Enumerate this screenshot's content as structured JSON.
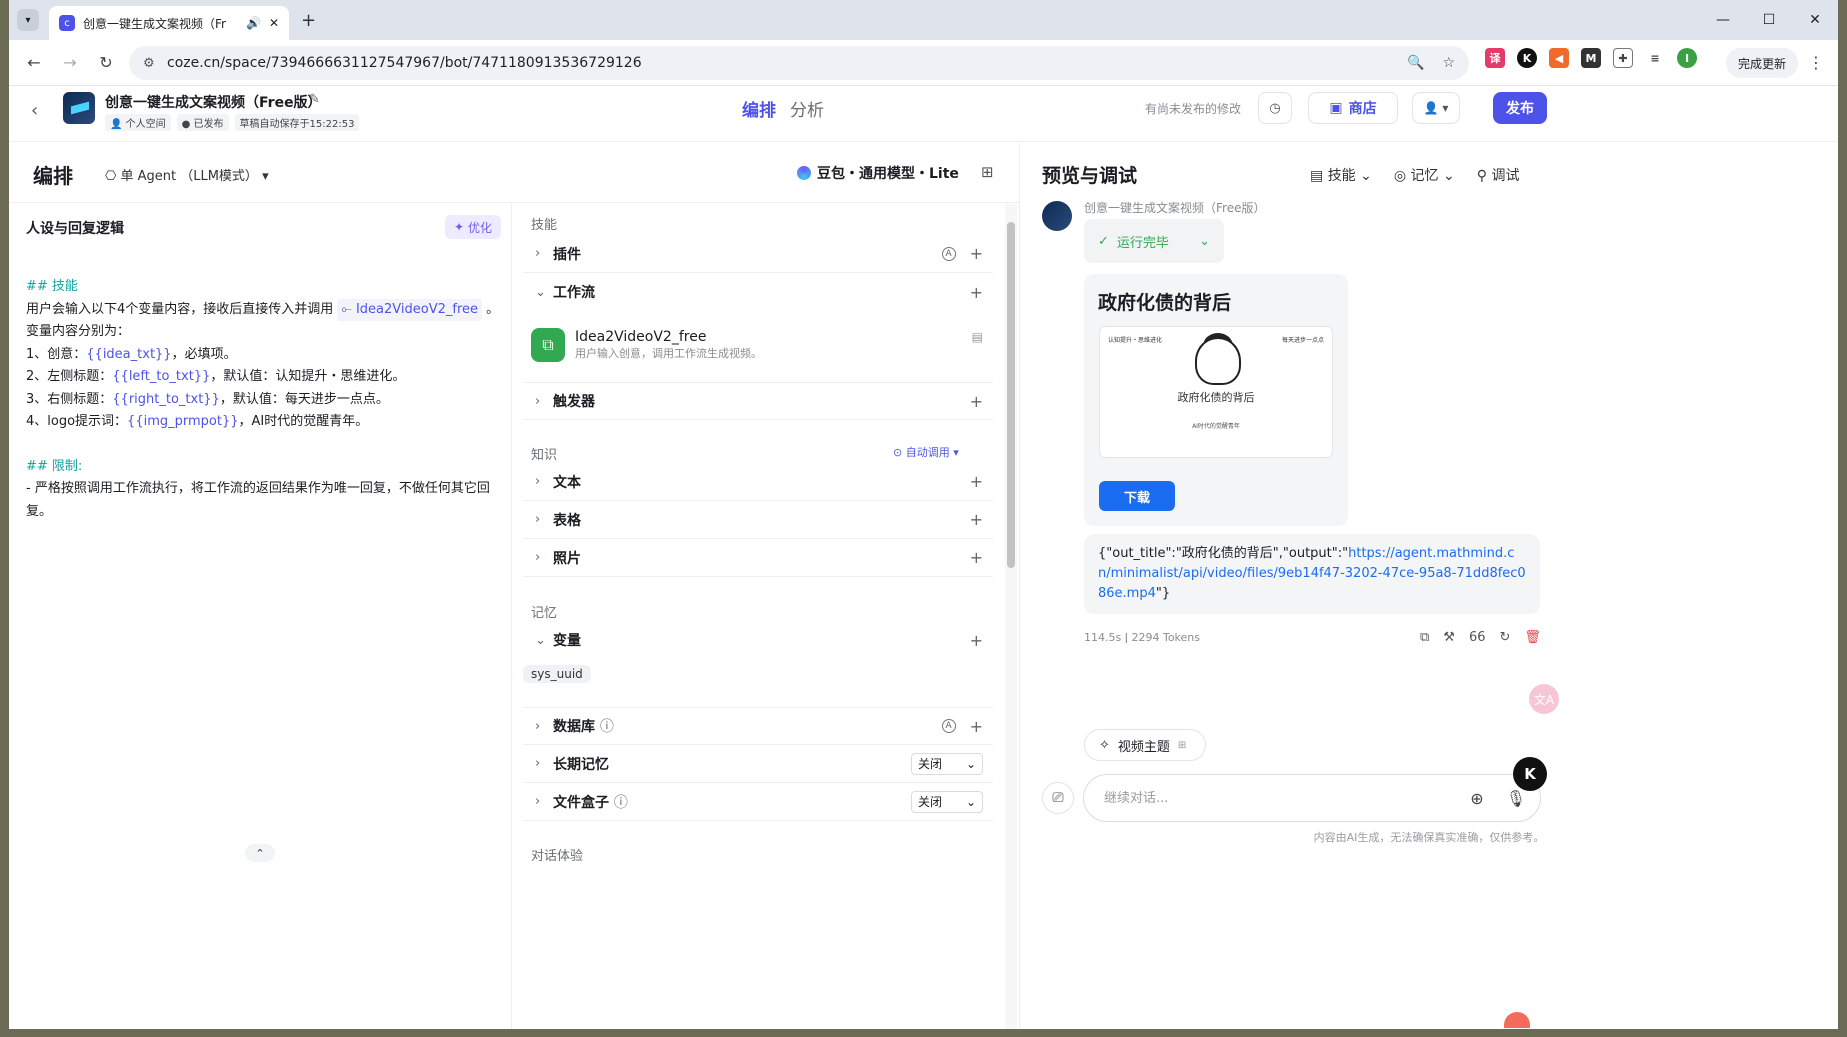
{
  "browser": {
    "tab_title": "创意一键生成文案视频（Fr",
    "url": "coze.cn/space/7394666631127547967/bot/7471180913536729126",
    "update_label": "完成更新",
    "window_controls": [
      "—",
      "☐",
      "✕"
    ]
  },
  "header": {
    "bot_name": "创意一键生成文案视频（Free版）",
    "badges": [
      "个人空间",
      "已发布",
      "草稿自动保存于15:22:53"
    ],
    "modes": [
      "编排",
      "分析"
    ],
    "unpublished_note": "有尚未发布的修改",
    "store_label": "商店",
    "publish_label": "发布"
  },
  "toolbar": {
    "title": "编排",
    "agent_mode": "单 Agent （LLM模式）",
    "model": "豆包・通用模型・Lite"
  },
  "persona": {
    "heading": "人设与回复逻辑",
    "optimize_label": "优化",
    "skills_h": "## 技能",
    "line1a": "用户会输入以下4个变量内容，接收后直接传入并调用",
    "workflow_ref": "Idea2VideoV2_free",
    "line1b": "。变量内容分别为：",
    "v1_pre": "1、创意：",
    "v1_var": "{{idea_txt}}",
    "v1_post": "，必填项。",
    "v2_pre": "2、左侧标题：",
    "v2_var": "{{left_to_txt}}",
    "v2_post": "，默认值：认知提升・思维进化。",
    "v3_pre": "3、右侧标题：",
    "v3_var": "{{right_to_txt}}",
    "v3_post": "，默认值：每天进步一点点。",
    "v4_pre": "4、logo提示词：",
    "v4_var": "{{img_prmpot}}",
    "v4_post": "，AI时代的觉醒青年。",
    "limit_h": "## 限制:",
    "limit_text": "- 严格按照调用工作流执行，将工作流的返回结果作为唯一回复，不做任何其它回复。"
  },
  "skills": {
    "section_skills": "技能",
    "plugins": "插件",
    "workflow": "工作流",
    "wf_name": "Idea2VideoV2_free",
    "wf_desc": "用户输入创意，调用工作流生成视频。",
    "trigger": "触发器",
    "section_knowledge": "知识",
    "auto_call": "自动调用",
    "text": "文本",
    "table": "表格",
    "photo": "照片",
    "section_memory": "记忆",
    "variables": "变量",
    "var_chip": "sys_uuid",
    "database": "数据库",
    "long_memory": "长期记忆",
    "long_memory_value": "关闭",
    "filebox": "文件盒子",
    "filebox_value": "关闭",
    "section_dialog": "对话体验"
  },
  "preview": {
    "title": "预览与调试",
    "tools": [
      "技能",
      "记忆",
      "调试"
    ],
    "bot_name": "创意一键生成文案视频（Free版）",
    "run_status": "运行完毕",
    "card_title": "政府化债的背后",
    "img_main": "政府化债的背后",
    "img_left": "认知提升・思维进化",
    "img_right": "每天进步一点点",
    "img_sub": "AI时代的觉醒青年",
    "download_label": "下载",
    "json_prefix": "{\"out_title\":\"政府化债的背后\",\"output\":\"",
    "json_link": "https://agent.mathmind.cn/minimalist/api/video/files/9eb14f47-3202-47ce-95a8-71dd8fec086e.mp4",
    "json_suffix": "\"}",
    "duration": "114.5s",
    "tokens": "2294 Tokens",
    "topic_label": "视频主题",
    "input_placeholder": "继续对话...",
    "disclaimer": "内容由AI生成，无法确保真实准确，仅供参考。"
  }
}
